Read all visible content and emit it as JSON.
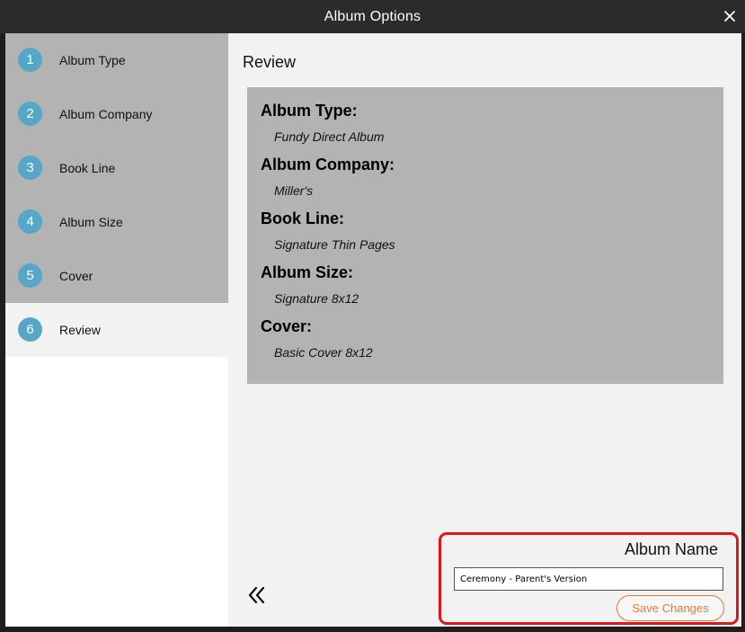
{
  "window": {
    "title": "Album Options",
    "close_icon": "close-icon"
  },
  "sidebar": {
    "steps": [
      {
        "num": "1",
        "label": "Album Type"
      },
      {
        "num": "2",
        "label": "Album Company"
      },
      {
        "num": "3",
        "label": "Book Line"
      },
      {
        "num": "4",
        "label": "Album Size"
      },
      {
        "num": "5",
        "label": "Cover"
      },
      {
        "num": "6",
        "label": "Review"
      }
    ],
    "active_index": 5
  },
  "main": {
    "heading": "Review",
    "review": [
      {
        "key": "Album Type:",
        "value": "Fundy Direct Album"
      },
      {
        "key": "Album Company:",
        "value": "Miller's"
      },
      {
        "key": "Book Line:",
        "value": "Signature Thin Pages"
      },
      {
        "key": "Album Size:",
        "value": "Signature 8x12"
      },
      {
        "key": "Cover:",
        "value": "Basic Cover 8x12"
      }
    ],
    "back_icon": "double-chevron-left-icon"
  },
  "album_name": {
    "label": "Album Name",
    "value": "Ceremony - Parent's Version",
    "save_label": "Save Changes"
  },
  "colors": {
    "step_badge": "#56a6c8",
    "save_accent": "#e07a3f",
    "highlight_border": "#e0161b"
  }
}
